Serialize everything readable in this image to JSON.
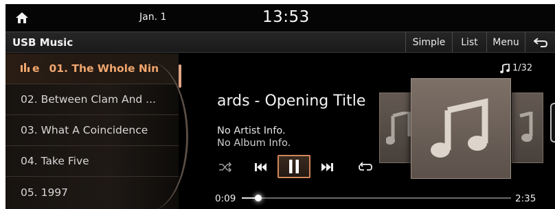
{
  "status": {
    "date": "Jan. 1",
    "time": "13:53"
  },
  "header": {
    "title": "USB Music",
    "buttons": {
      "simple": "Simple",
      "list": "List",
      "menu": "Menu"
    }
  },
  "playlist": {
    "active_prefix": "e",
    "items": [
      "01. The Whole Nin",
      "02. Between Clam And ...",
      "03. What A Coincidence",
      "04. Take Five",
      "05. 1997"
    ]
  },
  "now_playing": {
    "title": "ards - Opening Title",
    "artist": "No Artist Info.",
    "album": "No Album Info.",
    "track_counter": "1/32",
    "elapsed": "0:09",
    "total": "2:35",
    "progress_fraction": 0.06
  },
  "colors": {
    "accent": "#f0a66e",
    "background": "#000000"
  },
  "icons": {
    "home": "home-icon",
    "back": "back-arrow-icon",
    "note": "music-note-icon",
    "shuffle": "shuffle-icon",
    "prev": "previous-track-icon",
    "pause": "pause-icon",
    "next": "next-track-icon",
    "repeat": "repeat-icon"
  }
}
